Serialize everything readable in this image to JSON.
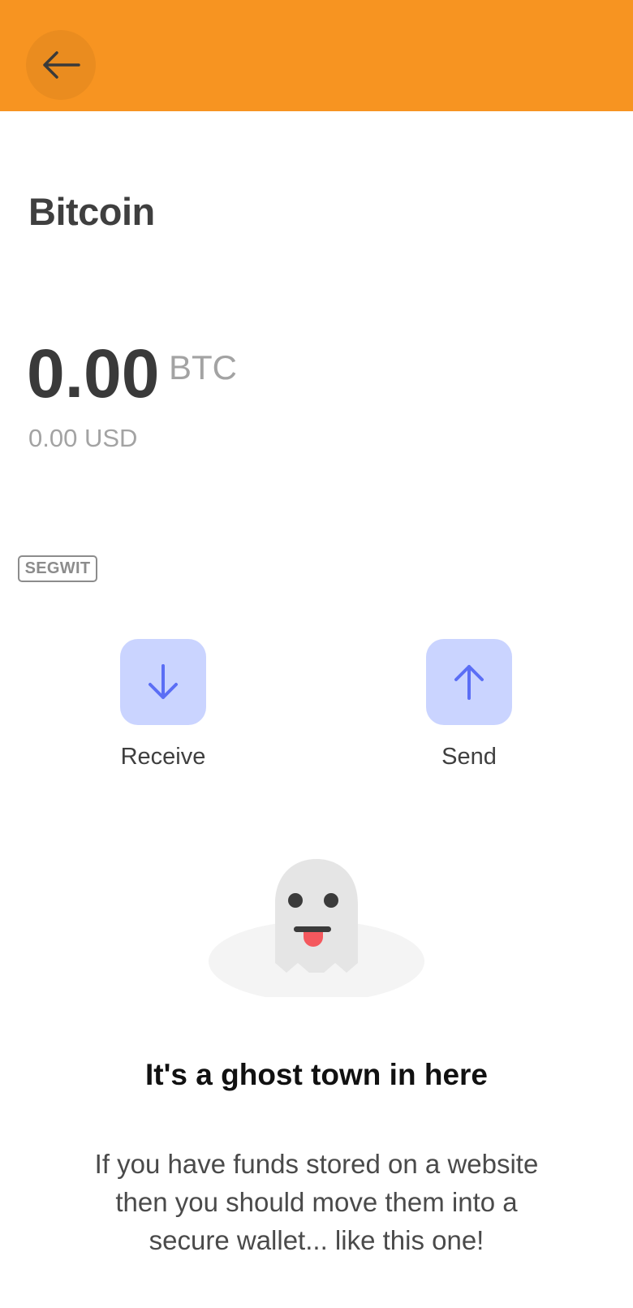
{
  "header": {
    "background_color": "#f79421",
    "back_icon": "arrow-left-icon"
  },
  "asset": {
    "title": "Bitcoin",
    "balance": "0.00",
    "unit": "BTC",
    "fiat": "0.00 USD",
    "badge": "SEGWIT"
  },
  "actions": {
    "receive": {
      "label": "Receive",
      "icon": "arrow-down-icon"
    },
    "send": {
      "label": "Send",
      "icon": "arrow-up-icon"
    },
    "icon_background": "#cad4ff",
    "icon_color": "#5b6ef5"
  },
  "empty_state": {
    "illustration": "ghost-illustration",
    "title": "It's a ghost town in here",
    "body": "If you have funds stored on a website then you should move them into a secure wallet... like this one!"
  }
}
